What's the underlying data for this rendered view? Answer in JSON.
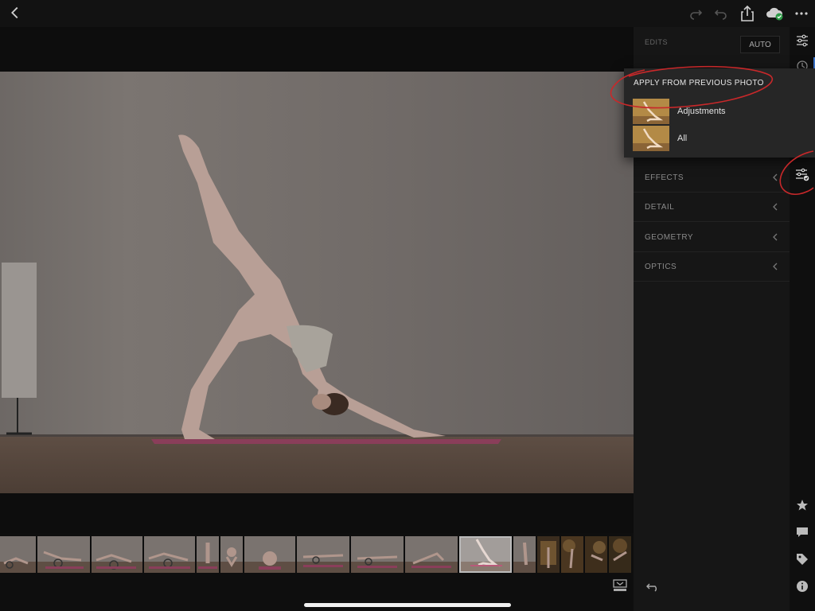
{
  "toolbar": {
    "icons": [
      "back-icon",
      "redo-icon",
      "undo-icon",
      "share-icon",
      "cloud-sync-icon",
      "more-icon"
    ]
  },
  "panel": {
    "header": "EDITS",
    "auto_label": "AUTO",
    "sections": [
      {
        "label": "EFFECTS",
        "key": "effects"
      },
      {
        "label": "DETAIL",
        "key": "detail"
      },
      {
        "label": "GEOMETRY",
        "key": "geometry"
      },
      {
        "label": "OPTICS",
        "key": "optics"
      }
    ]
  },
  "popup": {
    "title": "APPLY FROM PREVIOUS PHOTO",
    "items": [
      {
        "label": "Adjustments"
      },
      {
        "label": "All"
      }
    ]
  },
  "rail": {
    "icons": [
      "sliders-icon",
      "history-icon",
      "paste-settings-icon",
      "star-icon",
      "comment-icon",
      "tag-icon",
      "info-icon"
    ]
  },
  "colors": {
    "accent": "#3a72c8",
    "annotation": "#c8282a",
    "panel_bg": "#161616",
    "popup_bg": "#262626"
  }
}
